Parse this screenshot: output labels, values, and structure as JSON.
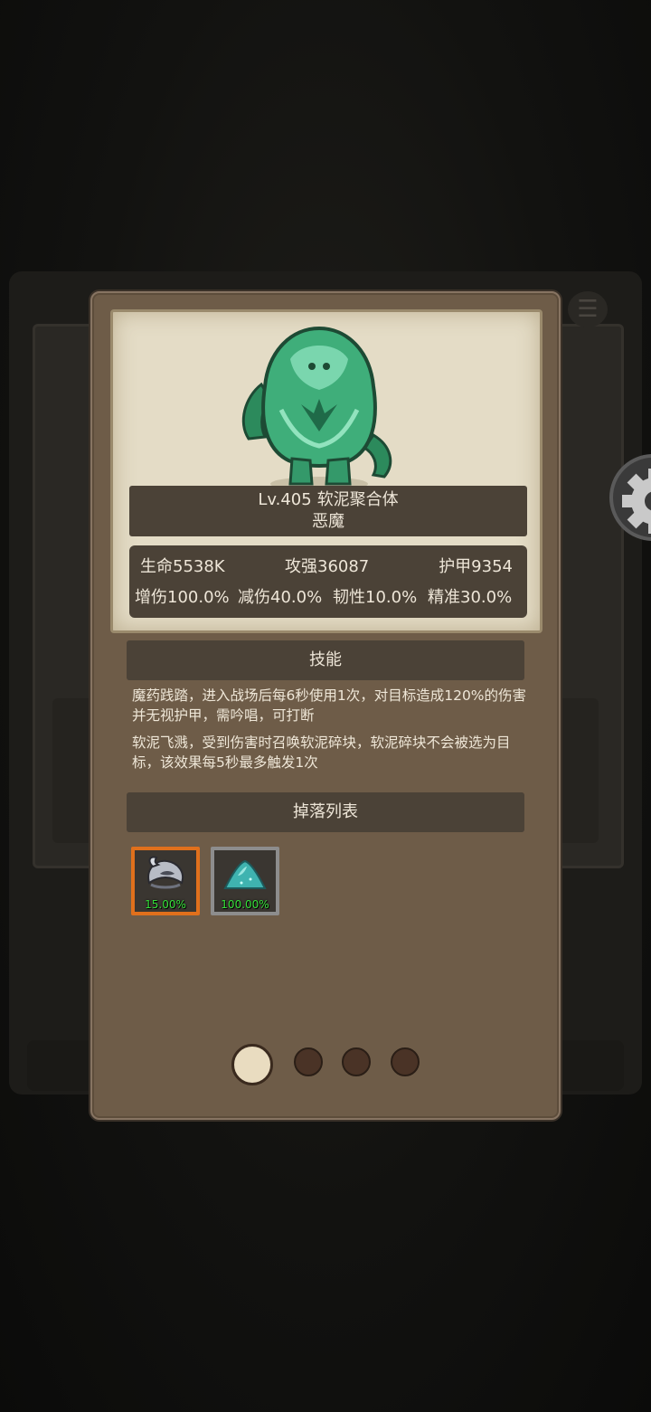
{
  "monster": {
    "level": "Lv.405",
    "name": "软泥聚合体",
    "type": "恶魔"
  },
  "stats": {
    "hp": "生命5538K",
    "attack": "攻强36087",
    "armor": "护甲9354",
    "damage_up": "增伤100.0%",
    "damage_reduction": "减伤40.0%",
    "toughness": "韧性10.0%",
    "accuracy": "精准30.0%"
  },
  "skills": {
    "header": "技能",
    "items": [
      "魔药践踏，进入战场后每6秒使用1次，对目标造成120%的伤害并无视护甲，需吟唱，可打断",
      "软泥飞溅，受到伤害时召唤软泥碎块，软泥碎块不会被选为目标，该效果每5秒最多触发1次"
    ]
  },
  "drops": {
    "header": "掉落列表",
    "items": [
      {
        "icon": "horn-helmet-icon",
        "rate": "15.00%",
        "rarity_color": "#e0701c"
      },
      {
        "icon": "dust-pile-icon",
        "rate": "100.00%",
        "rarity_color": "#8d8d8d"
      }
    ]
  },
  "pagination": {
    "total": 4,
    "current": 1
  },
  "colors": {
    "monster": "#2f9a6a",
    "drop_rate": "#36e23a"
  }
}
